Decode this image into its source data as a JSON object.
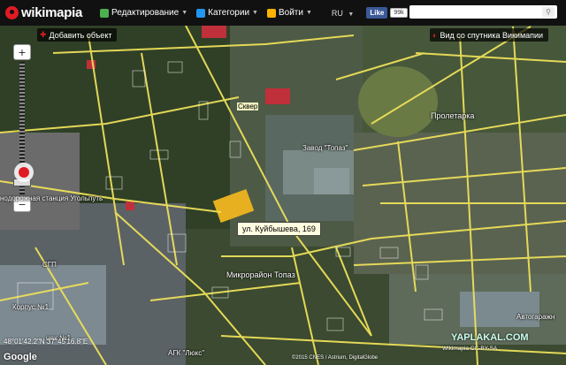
{
  "topbar": {
    "logo": "wikimapia",
    "menu": [
      {
        "label": "Редактирование",
        "icon": "edit-icon",
        "color": "#4caf50"
      },
      {
        "label": "Категории",
        "icon": "flag-icon",
        "color": "#2196f3"
      },
      {
        "label": "Войти",
        "icon": "user-icon",
        "color": "#ffb300"
      }
    ],
    "lang": "RU",
    "fb_like": "Like",
    "fb_count": "99k"
  },
  "buttons": {
    "add_object": "Добавить объект",
    "satellite": "Вид со спутника Викимапии"
  },
  "map": {
    "tooltip": "ул. Куйбышева, 169",
    "labels": [
      {
        "text": "Пролетарка",
        "white": true
      },
      {
        "text": "Завод \"Топаз\"",
        "white": true
      },
      {
        "text": "Микрорайон Топаз",
        "white": true
      },
      {
        "text": "нодорожная станция Угольпуть",
        "white": true
      },
      {
        "text": "Корпус №1",
        "white": true
      },
      {
        "text": "цех №1",
        "white": true
      },
      {
        "text": "Сквер",
        "white": false
      },
      {
        "text": "СГП",
        "white": true
      },
      {
        "text": "Автогаражн",
        "white": true
      },
      {
        "text": "АГК \"Люкс\"",
        "white": true
      }
    ],
    "coordinates": "48°01'42.2\"N 37°45'16.8\"E",
    "google": "Google",
    "copyright": "©2015 CNES / Astrium, DigitalGlobe",
    "cc": "Wikimapia CC-BY-SA",
    "watermark": "YAPLAKAL.COM"
  },
  "colors": {
    "road": "#f2e24a",
    "accent": "#e01b24"
  }
}
